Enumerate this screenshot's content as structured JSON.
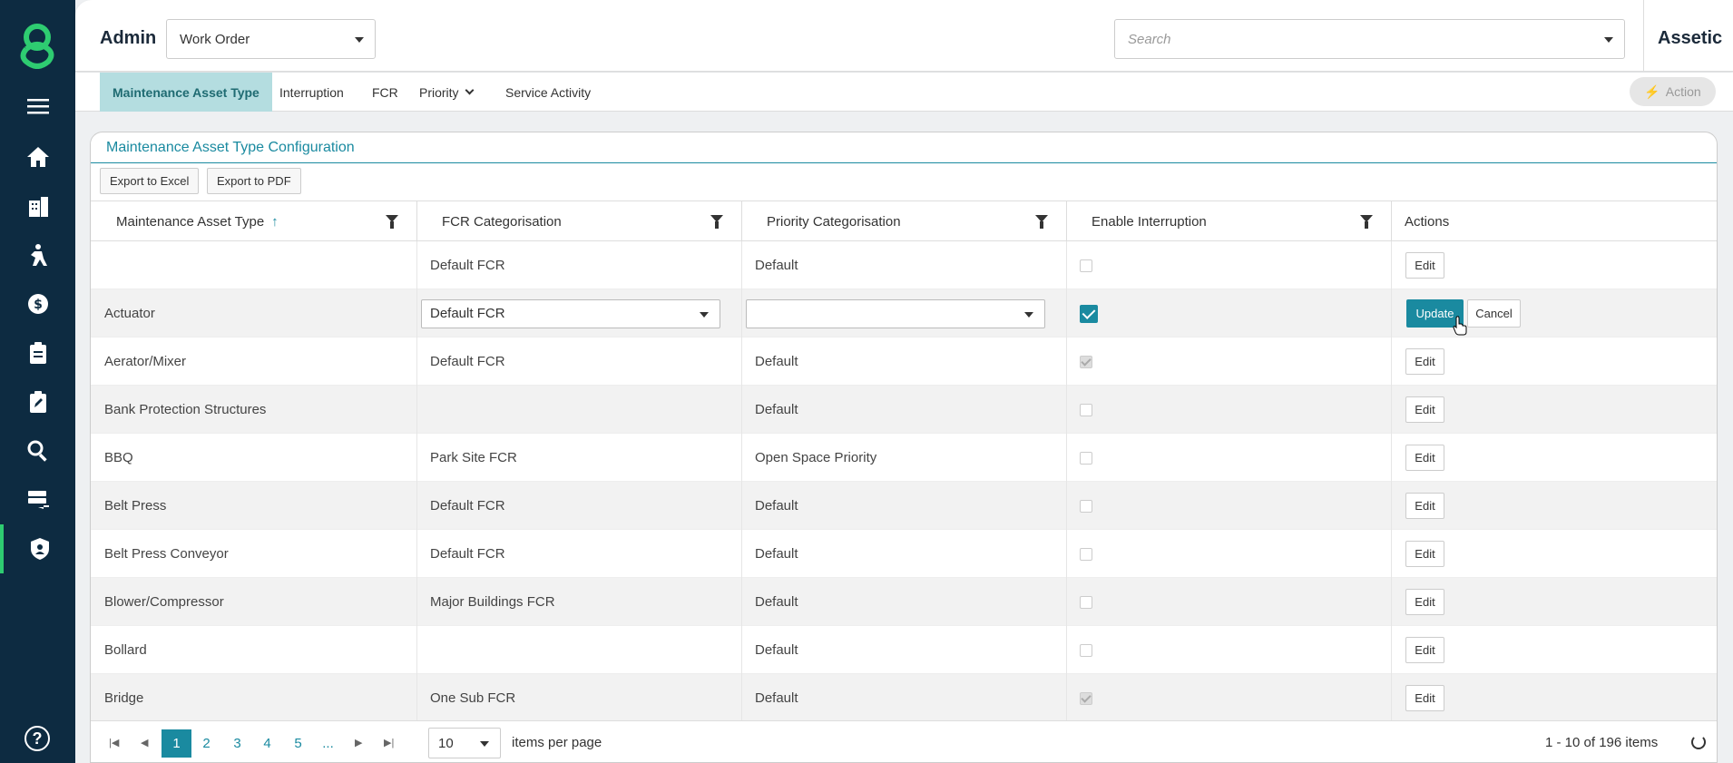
{
  "header": {
    "title": "Admin",
    "module": "Work Order",
    "search_placeholder": "Search",
    "brand": "Assetic"
  },
  "tabs": [
    {
      "label": "Maintenance Asset Type",
      "active": true
    },
    {
      "label": "Interruption"
    },
    {
      "label": "FCR"
    },
    {
      "label": "Priority",
      "dropdown": true
    },
    {
      "label": "Service Activity"
    }
  ],
  "action_label": "Action",
  "panel": {
    "title": "Maintenance Asset Type Configuration",
    "export_excel": "Export to Excel",
    "export_pdf": "Export to PDF"
  },
  "columns": [
    "Maintenance Asset Type",
    "FCR Categorisation",
    "Priority Categorisation",
    "Enable Interruption",
    "Actions"
  ],
  "sort_indicator": "↑",
  "edit_label": "Edit",
  "update_label": "Update",
  "cancel_label": "Cancel",
  "rows": [
    {
      "type": "",
      "fcr": "Default FCR",
      "priority": "Default",
      "interruption": false
    },
    {
      "type": "Actuator",
      "fcr": "Default FCR",
      "priority": "",
      "interruption": true,
      "editing": true
    },
    {
      "type": "Aerator/Mixer",
      "fcr": "Default FCR",
      "priority": "Default",
      "interruption": true
    },
    {
      "type": "Bank Protection Structures",
      "fcr": "",
      "priority": "Default",
      "interruption": false
    },
    {
      "type": "BBQ",
      "fcr": "Park Site FCR",
      "priority": "Open Space Priority",
      "interruption": false
    },
    {
      "type": "Belt Press",
      "fcr": "Default FCR",
      "priority": "Default",
      "interruption": false
    },
    {
      "type": "Belt Press Conveyor",
      "fcr": "Default FCR",
      "priority": "Default",
      "interruption": false
    },
    {
      "type": "Blower/Compressor",
      "fcr": "Major Buildings FCR",
      "priority": "Default",
      "interruption": false
    },
    {
      "type": "Bollard",
      "fcr": "",
      "priority": "Default",
      "interruption": false
    },
    {
      "type": "Bridge",
      "fcr": "One Sub FCR",
      "priority": "Default",
      "interruption": true
    }
  ],
  "pager": {
    "pages": [
      "1",
      "2",
      "3",
      "4",
      "5",
      "..."
    ],
    "current": "1",
    "page_size": "10",
    "items_per_page_label": "items per page",
    "info": "1 - 10 of 196 items"
  },
  "colors": {
    "sidebar": "#0d2b41",
    "accent": "#1a8aa0",
    "logo": "#2ecc71"
  }
}
